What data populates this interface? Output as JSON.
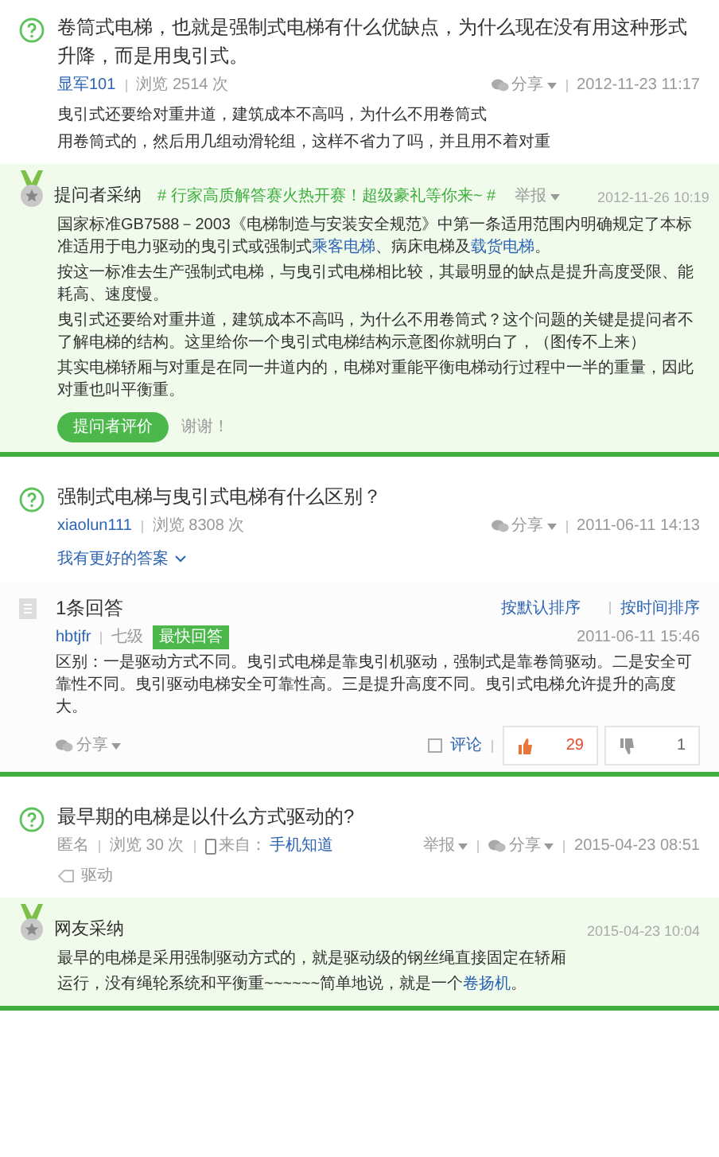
{
  "threads": [
    {
      "question": {
        "title": "卷筒式电梯，也就是强制式电梯有什么优缺点，为什么现在没有用这种形式升降，而是用曳引式。",
        "meta": [
          {
            "kind": "user",
            "text": "显军101"
          },
          {
            "kind": "text",
            "text": "浏览 2514 次"
          }
        ],
        "meta_right": [
          {
            "kind": "share",
            "text": "分享"
          },
          {
            "kind": "text",
            "text": "2012-11-23 11:17"
          }
        ],
        "description": [
          "曳引式还要给对重井道，建筑成本不高吗，为什么不用卷筒式",
          "用卷筒式的，然后用几组动滑轮组，这样不省力了吗，并且用不着对重"
        ]
      },
      "answer": {
        "kind": "adopted",
        "label": "提问者采纳",
        "promo": "# 行家高质解答赛火热开赛！超级豪礼等你来~ #",
        "report": "举报",
        "date": "2012-11-26 10:19",
        "body": [
          [
            {
              "text": "国家标准GB7588－2003《电梯制造与安装安全规范》中第一条适用范围内明确规定了本标准适用于电力驱动的曳引式或强制式"
            },
            {
              "text": "乘客电梯",
              "link": true
            },
            {
              "text": "、病床电梯及"
            },
            {
              "text": "载货电梯",
              "link": true
            },
            {
              "text": "。"
            }
          ],
          [
            {
              "text": "按这一标准去生产强制式电梯，与曳引式电梯相比较，其最明显的缺点是提升高度受限、能耗高、速度慢。"
            }
          ],
          [
            {
              "text": "曳引式还要给对重井道，建筑成本不高吗，为什么不用卷筒式？这个问题的关键是提问者不了解电梯的结构。这里给你一个曳引式电梯结构示意图你就明白了，（图传不上来）"
            }
          ],
          [
            {
              "text": "其实电梯轿厢与对重是在同一井道内的，电梯对重能平衡电梯动行过程中一半的重量，因此对重也叫平衡重。"
            }
          ]
        ],
        "rating_button": "提问者评价",
        "thanks": "谢谢！"
      }
    },
    {
      "question": {
        "title": "强制式电梯与曳引式电梯有什么区别？",
        "meta": [
          {
            "kind": "user",
            "text": "xiaolun111"
          },
          {
            "kind": "text",
            "text": "浏览 8308 次"
          }
        ],
        "meta_right": [
          {
            "kind": "share",
            "text": "分享"
          },
          {
            "kind": "text",
            "text": "2011-06-11 14:13"
          }
        ],
        "better_answer": "我有更好的答案"
      },
      "answer": {
        "kind": "list",
        "count": "1条回答",
        "sorts": [
          "按默认排序",
          "按时间排序"
        ],
        "user": "hbtjfr",
        "level": "七级",
        "badge": "最快回答",
        "date": "2011-06-11 15:46",
        "body": [
          [
            {
              "text": "区别：一是驱动方式不同。曳引式电梯是靠曳引机驱动，强制式是靠卷筒驱动。二是安全可靠性不同。曳引驱动电梯安全可靠性高。三是提升高度不同。曳引式电梯允许提升的高度大。"
            }
          ]
        ],
        "share": "分享",
        "comment": "评论",
        "likes": "29",
        "dislikes": "1"
      }
    },
    {
      "question": {
        "title": "最早期的电梯是以什么方式驱动的?",
        "meta": [
          {
            "kind": "text",
            "text": "匿名"
          },
          {
            "kind": "text",
            "text": "浏览 30 次"
          },
          {
            "kind": "source",
            "text": "来自：",
            "link": "手机知道"
          }
        ],
        "meta_right": [
          {
            "kind": "report",
            "text": "举报"
          },
          {
            "kind": "share",
            "text": "分享"
          },
          {
            "kind": "text",
            "text": "2015-04-23 08:51"
          }
        ],
        "tag": "驱动"
      },
      "answer": {
        "kind": "adopted",
        "label": "网友采纳",
        "date": "2015-04-23 10:04",
        "body": [
          [
            {
              "text": "最早的电梯是采用强制驱动方式的，就是驱动级的钢丝绳直接固定在轿厢"
            }
          ],
          [
            {
              "text": "运行，没有绳轮系统和平衡重~~~~~~简单地说，就是一个"
            },
            {
              "text": "卷扬机",
              "link": true
            },
            {
              "text": "。"
            }
          ]
        ]
      }
    }
  ]
}
